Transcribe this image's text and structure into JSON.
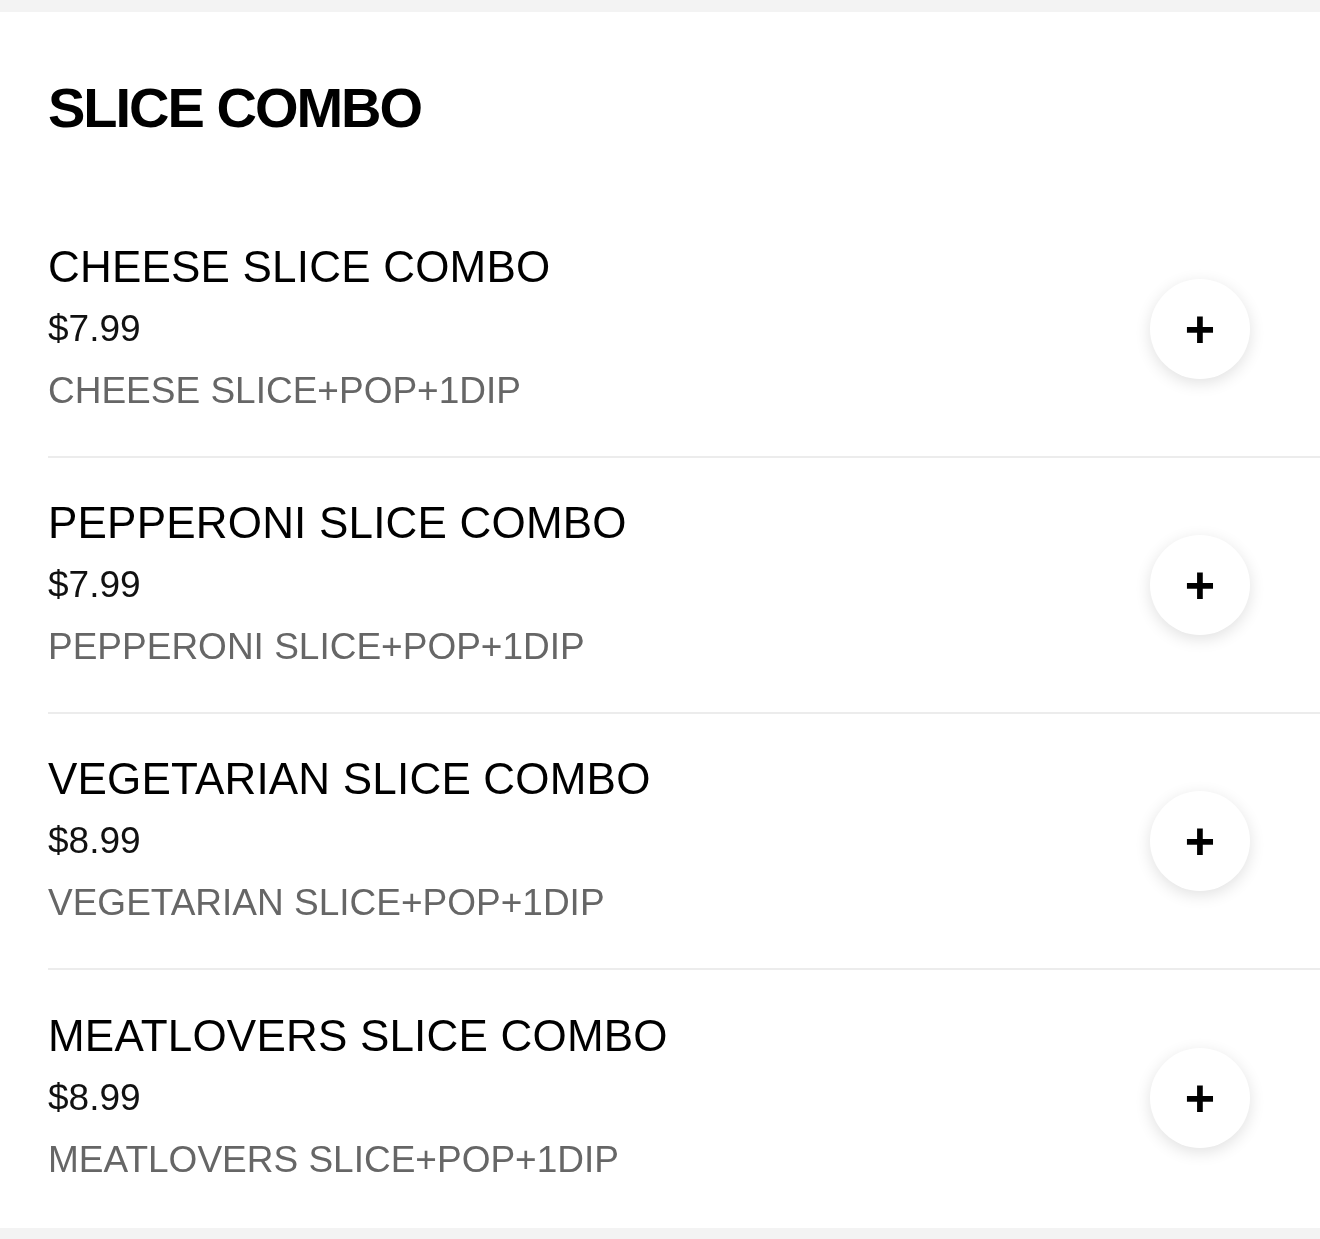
{
  "section": {
    "title": "SLICE COMBO",
    "items": [
      {
        "name": "CHEESE SLICE COMBO",
        "price": "$7.99",
        "description": "CHEESE SLICE+POP+1DIP",
        "add_label": "+"
      },
      {
        "name": "PEPPERONI SLICE COMBO",
        "price": "$7.99",
        "description": "PEPPERONI SLICE+POP+1DIP",
        "add_label": "+"
      },
      {
        "name": "VEGETARIAN SLICE COMBO",
        "price": "$8.99",
        "description": "VEGETARIAN SLICE+POP+1DIP",
        "add_label": "+"
      },
      {
        "name": "MEATLOVERS SLICE COMBO",
        "price": "$8.99",
        "description": "MEATLOVERS SLICE+POP+1DIP",
        "add_label": "+"
      }
    ]
  }
}
